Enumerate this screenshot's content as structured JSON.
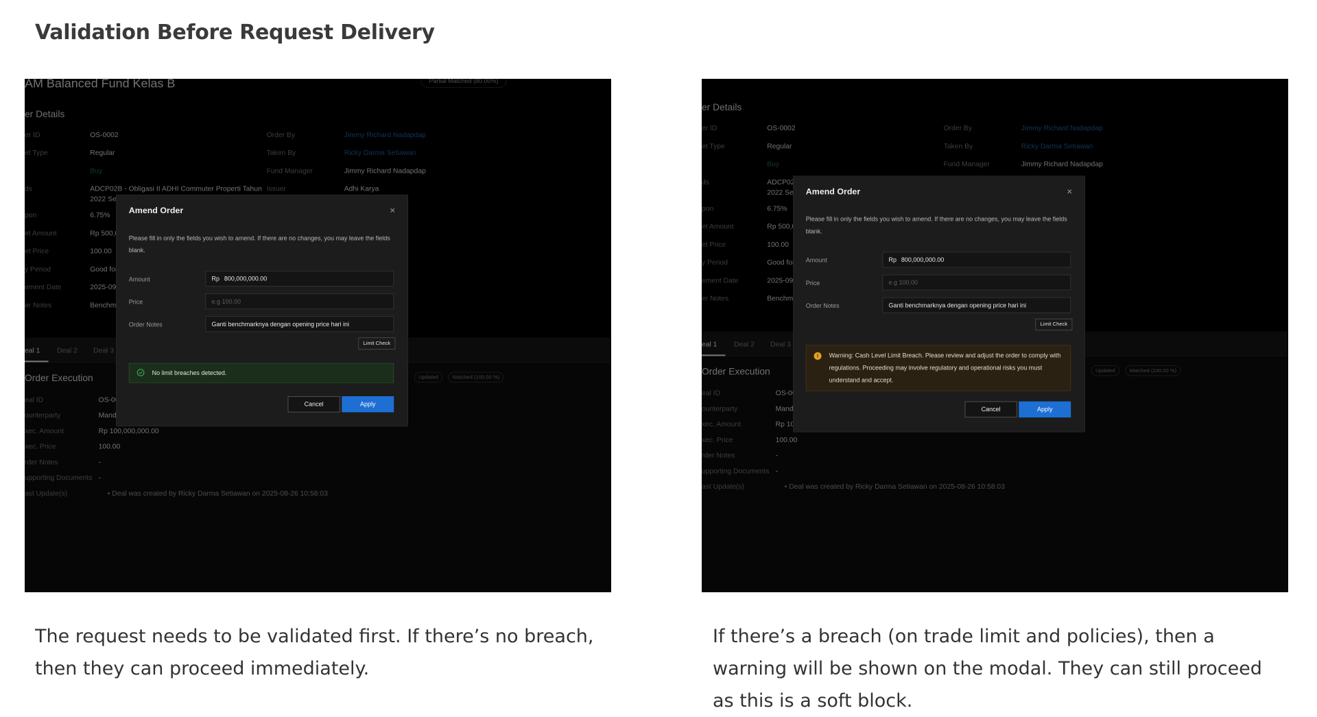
{
  "page": {
    "title": "Validation Before Request Delivery",
    "caption_left": "The request needs to be validated first. If there’s no breach, then they can proceed immediately.",
    "caption_right": "If there’s a breach (on trade limit and policies), then a warning will be shown on the modal. They can still proceed as this is a soft block."
  },
  "bg": {
    "fund_title": "AM Balanced Fund Kelas B",
    "status_badge": "Partial Matched (80.00%)",
    "section_order_details": "er Details",
    "rows_left": [
      {
        "label": "er ID",
        "value": "OS-0002"
      },
      {
        "label": "et Type",
        "value": "Regular"
      },
      {
        "label": "",
        "value": "Buy"
      },
      {
        "label": "ds",
        "value": "ADCP02B - Obligasi II ADHI Commuter Properti Tahun"
      },
      {
        "label": "",
        "value": "2022 Ser"
      },
      {
        "label": "pon",
        "value": "6.75%"
      },
      {
        "label": "et Amount",
        "value": "Rp 500,0"
      },
      {
        "label": "et Price",
        "value": "100.00"
      },
      {
        "label": "y Period",
        "value": "Good for"
      },
      {
        "label": "ement Date",
        "value": "2025-09"
      },
      {
        "label": "er Notes",
        "value": "Benchma"
      }
    ],
    "rows_right": [
      {
        "label": "Order By",
        "value": "Jimmy Richard Nadapdap"
      },
      {
        "label": "Taken By",
        "value": "Ricky Darma Setiawan"
      },
      {
        "label": "Fund Manager",
        "value": "Jimmy Richard Nadapdap"
      },
      {
        "label": "Issuer",
        "value": "Adhi Karya"
      }
    ],
    "tabs": [
      "eal 1",
      "Deal 2",
      "Deal 3"
    ],
    "section_execution": "Order Execution",
    "badge_updated": "Updated",
    "badge_matched": "Matched (100.00 %)",
    "exec_rows": [
      {
        "label": "eal ID",
        "value": "OS-0C"
      },
      {
        "label": "ounterparty",
        "value": "Mandi"
      },
      {
        "label": "xec. Amount",
        "value": "Rp 100,000,000.00"
      },
      {
        "label": "xec. Price",
        "value": "100.00"
      },
      {
        "label": "rder Notes",
        "value": "-"
      },
      {
        "label": "upporting Documents",
        "value": "-"
      },
      {
        "label": "ast Update(s)",
        "value": "• Deal was created by Ricky Darma Setiawan on 2025-08-26 10:58:03"
      }
    ],
    "exec_rows_right": [
      {
        "value": "OS-0C"
      },
      {
        "value": "Mandi"
      },
      {
        "value": "Rp 100"
      },
      {
        "value": "100.00"
      },
      {
        "value": "-"
      },
      {
        "value": "-"
      },
      {
        "value": "• Deal was created by Ricky Darma Setiawan on 2025-08-26 10:58:03"
      }
    ],
    "right_rows_left": [
      {
        "label": "er ID",
        "value": "OS-0002"
      },
      {
        "label": "et Type",
        "value": "Regular"
      },
      {
        "label": "",
        "value": "Buy"
      },
      {
        "label": "ds",
        "value": "ADCP02E"
      },
      {
        "label": "",
        "value": "2022 Ser"
      },
      {
        "label": "pon",
        "value": "6.75%"
      },
      {
        "label": "et Amount",
        "value": "Rp 500,0"
      },
      {
        "label": "et Price",
        "value": "100.00"
      },
      {
        "label": "y Period",
        "value": "Good for"
      },
      {
        "label": "ement Date",
        "value": "2025-09"
      },
      {
        "label": "er Notes",
        "value": "Benchma"
      }
    ],
    "right_rows_right": [
      {
        "label": "Order By",
        "value": "Jimmy Richard Nadapdap"
      },
      {
        "label": "Taken By",
        "value": "Ricky Darma Setiawan"
      },
      {
        "label": "Fund Manager",
        "value": "Jimmy Richard Nadapdap"
      }
    ]
  },
  "modal": {
    "title": "Amend Order",
    "close": "×",
    "description": "Please fill in only the fields you wish to amend. If there are no changes, you may leave the fields blank.",
    "amount_label": "Amount",
    "amount_prefix": "Rp",
    "amount_value": "800,000,000.00",
    "price_label": "Price",
    "price_placeholder": "e.g 100.00",
    "notes_label": "Order Notes",
    "notes_value": "Ganti benchmarknya dengan opening price hari ini",
    "limit_check": "Limit Check",
    "success_text": "No limit breaches detected.",
    "warning_text": "Warning: Cash Level Limit Breach. Please review and adjust the order to comply with regulations. Proceeding may involve regulatory and operational risks you must understand and accept.",
    "warning_icon": "!",
    "cancel": "Cancel",
    "apply": "Apply"
  },
  "colors": {
    "success_icon": "#3fae5a",
    "warning_icon": "#e0a21f",
    "apply": "#1d6fd4"
  }
}
